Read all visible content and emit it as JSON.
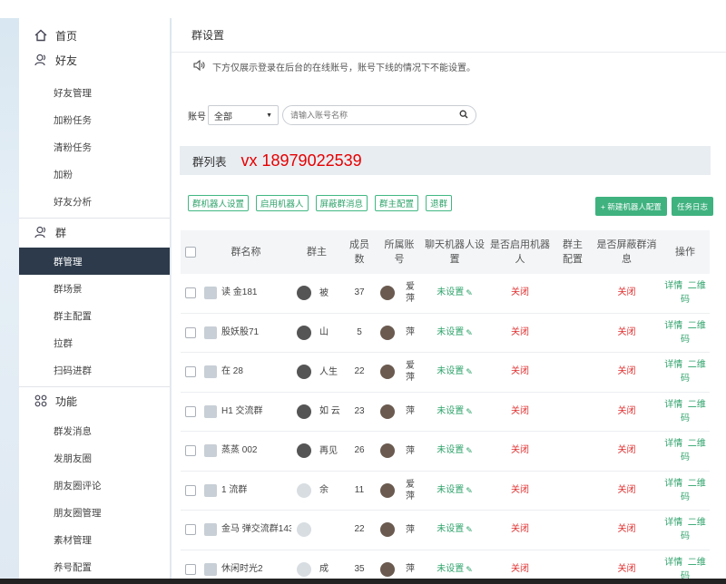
{
  "sidebar": {
    "home": "首页",
    "friends_group": "好友",
    "friends_items": [
      "好友管理",
      "加粉任务",
      "清粉任务",
      "加粉",
      "好友分析"
    ],
    "group_group": "群",
    "group_items": [
      "群管理",
      "群场景",
      "群主配置",
      "拉群",
      "扫码进群"
    ],
    "func_group": "功能",
    "func_items": [
      "群发消息",
      "发朋友圈",
      "朋友圈评论",
      "朋友圈管理",
      "素材管理",
      "养号配置"
    ]
  },
  "page": {
    "title": "群设置",
    "notice": "下方仅展示登录在后台的在线账号，账号下线的情况下不能设置。"
  },
  "filter": {
    "label": "账号",
    "selected": "全部",
    "placeholder": "请输入账号名称"
  },
  "list": {
    "title": "群列表",
    "overlay": "vx 18979022539"
  },
  "buttons": {
    "robot_setting": "群机器人设置",
    "enable_robot": "启用机器人",
    "block_msg": "屏蔽群消息",
    "owner_config": "群主配置",
    "quit": "退群",
    "new_robot": "+ 新建机器人配置",
    "task_log": "任务日志"
  },
  "table": {
    "headers": [
      "群名称",
      "群主",
      "成员数",
      "所属账号",
      "聊天机器人设置",
      "是否启用机器人",
      "群主配置",
      "是否屏蔽群消息",
      "操作"
    ],
    "rows": [
      {
        "name": "读 金181",
        "owner": "被",
        "members": "37",
        "account": "爱萍",
        "chat": "未设置",
        "enabled": "关闭",
        "block": "关闭"
      },
      {
        "name": "股妖股71",
        "owner": "山",
        "members": "5",
        "account": "萍",
        "chat": "未设置",
        "enabled": "关闭",
        "block": "关闭"
      },
      {
        "name": "在 28",
        "owner": "人生",
        "members": "22",
        "account": "爱萍",
        "chat": "未设置",
        "enabled": "关闭",
        "block": "关闭"
      },
      {
        "name": "H1 交流群",
        "owner": "如 云",
        "members": "23",
        "account": "萍",
        "chat": "未设置",
        "enabled": "关闭",
        "block": "关闭"
      },
      {
        "name": "蒸蒸 002",
        "owner": "再见",
        "members": "26",
        "account": "萍",
        "chat": "未设置",
        "enabled": "关闭",
        "block": "关闭"
      },
      {
        "name": "1 流群",
        "owner": "余",
        "members": "11",
        "account": "爱萍",
        "chat": "未设置",
        "enabled": "关闭",
        "block": "关闭"
      },
      {
        "name": "金马 弹交流群143",
        "owner": "",
        "members": "22",
        "account": "萍",
        "chat": "未设置",
        "enabled": "关闭",
        "block": "关闭"
      },
      {
        "name": "休闲时光2",
        "owner": "成",
        "members": "35",
        "account": "萍",
        "chat": "未设置",
        "enabled": "关闭",
        "block": "关闭"
      }
    ],
    "op_detail": "详情",
    "op_qr": "二维码"
  }
}
